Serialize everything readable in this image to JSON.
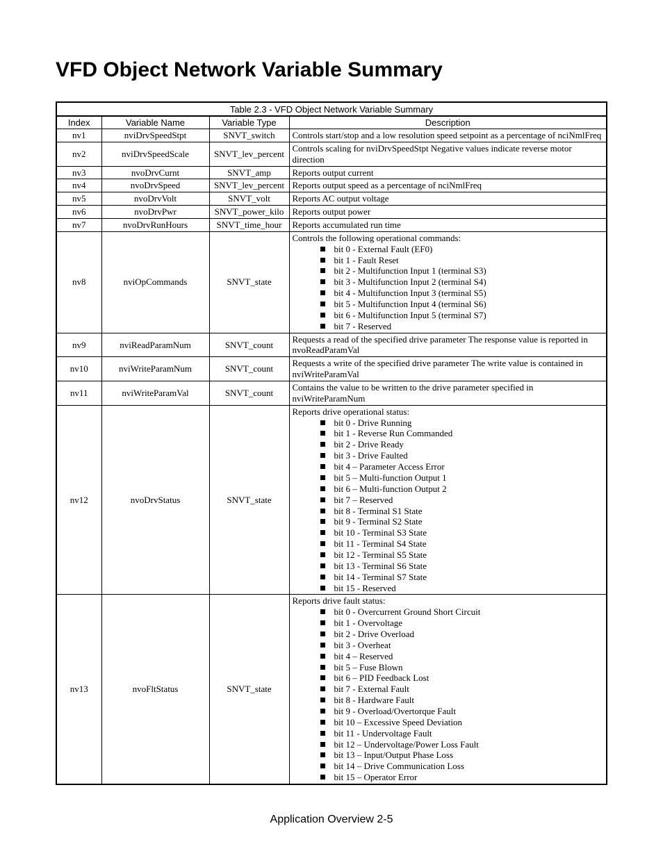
{
  "title": "VFD Object Network Variable Summary",
  "table_caption": "Table 2.3 - VFD Object Network Variable Summary",
  "headers": {
    "index": "Index",
    "name": "Variable Name",
    "type": "Variable Type",
    "desc": "Description"
  },
  "rows": [
    {
      "index": "nv1",
      "name": "nviDrvSpeedStpt",
      "type": "SNVT_switch",
      "desc": "Controls start/stop and a low resolution speed setpoint as a percentage of nciNmlFreq"
    },
    {
      "index": "nv2",
      "name": "nviDrvSpeedScale",
      "type": "SNVT_lev_percent",
      "desc": "Controls scaling for nviDrvSpeedStpt Negative values indicate reverse motor direction"
    },
    {
      "index": "nv3",
      "name": "nvoDrvCurnt",
      "type": "SNVT_amp",
      "desc": "Reports output current"
    },
    {
      "index": "nv4",
      "name": "nvoDrvSpeed",
      "type": "SNVT_lev_percent",
      "desc": "Reports output speed as a percentage of nciNmlFreq"
    },
    {
      "index": "nv5",
      "name": "nvoDrvVolt",
      "type": "SNVT_volt",
      "desc": "Reports AC output voltage"
    },
    {
      "index": "nv6",
      "name": "nvoDrvPwr",
      "type": "SNVT_power_kilo",
      "desc": "Reports output power"
    },
    {
      "index": "nv7",
      "name": "nvoDrvRunHours",
      "type": "SNVT_time_hour",
      "desc": "Reports accumulated run time"
    },
    {
      "index": "nv8",
      "name": "nviOpCommands",
      "type": "SNVT_state",
      "desc_intro": "Controls the following operational commands:",
      "bits": [
        "bit 0 - External Fault (EF0)",
        "bit 1 - Fault Reset",
        "bit 2 - Multifunction Input 1 (terminal S3)",
        "bit 3 - Multifunction Input 2 (terminal S4)",
        "bit 4 - Multifunction Input 3 (terminal S5)",
        "bit 5 - Multifunction Input 4 (terminal S6)",
        "bit 6 - Multifunction Input 5 (terminal S7)",
        "bit 7 - Reserved"
      ]
    },
    {
      "index": "nv9",
      "name": "nviReadParamNum",
      "type": "SNVT_count",
      "desc": "Requests a read of the specified drive parameter The response value is reported in nvoReadParamVal"
    },
    {
      "index": "nv10",
      "name": "nviWriteParamNum",
      "type": "SNVT_count",
      "desc": "Requests a write of the specified drive parameter The write value is contained in nviWriteParamVal"
    },
    {
      "index": "nv11",
      "name": "nviWriteParamVal",
      "type": "SNVT_count",
      "desc": "Contains the value to be written to the drive parameter specified in nviWriteParamNum"
    },
    {
      "index": "nv12",
      "name": "nvoDrvStatus",
      "type": "SNVT_state",
      "desc_intro": "Reports drive operational status:",
      "bits": [
        "bit 0 - Drive Running",
        "bit 1 - Reverse Run Commanded",
        "bit 2 - Drive Ready",
        "bit 3 - Drive Faulted",
        "bit 4 – Parameter Access Error",
        "bit 5 – Multi-function Output 1",
        "bit 6 – Multi-function Output 2",
        "bit 7 – Reserved",
        "bit 8 - Terminal S1 State",
        "bit 9 - Terminal S2 State",
        "bit 10 - Terminal S3 State",
        "bit 11 - Terminal S4 State",
        "bit 12 - Terminal S5 State",
        "bit 13 - Terminal S6 State",
        "bit 14 - Terminal S7 State",
        "bit 15 - Reserved"
      ]
    },
    {
      "index": "nv13",
      "name": "nvoFltStatus",
      "type": "SNVT_state",
      "desc_intro": "Reports drive fault status:",
      "bits": [
        "bit 0 - Overcurrent Ground Short Circuit",
        "bit 1 - Overvoltage",
        "bit 2 - Drive Overload",
        "bit 3 - Overheat",
        "bit 4 – Reserved",
        "bit 5 – Fuse Blown",
        "bit 6 – PID Feedback Lost",
        "bit 7 - External Fault",
        "bit 8 - Hardware Fault",
        "bit 9 - Overload/Overtorque Fault",
        "bit 10 – Excessive Speed Deviation",
        "bit 11 - Undervoltage Fault",
        "bit 12 – Undervoltage/Power Loss Fault",
        "bit 13 – Input/Output Phase Loss",
        "bit 14 – Drive Communication Loss",
        "bit 15 – Operator Error"
      ]
    }
  ],
  "footer": "Application Overview 2-5"
}
